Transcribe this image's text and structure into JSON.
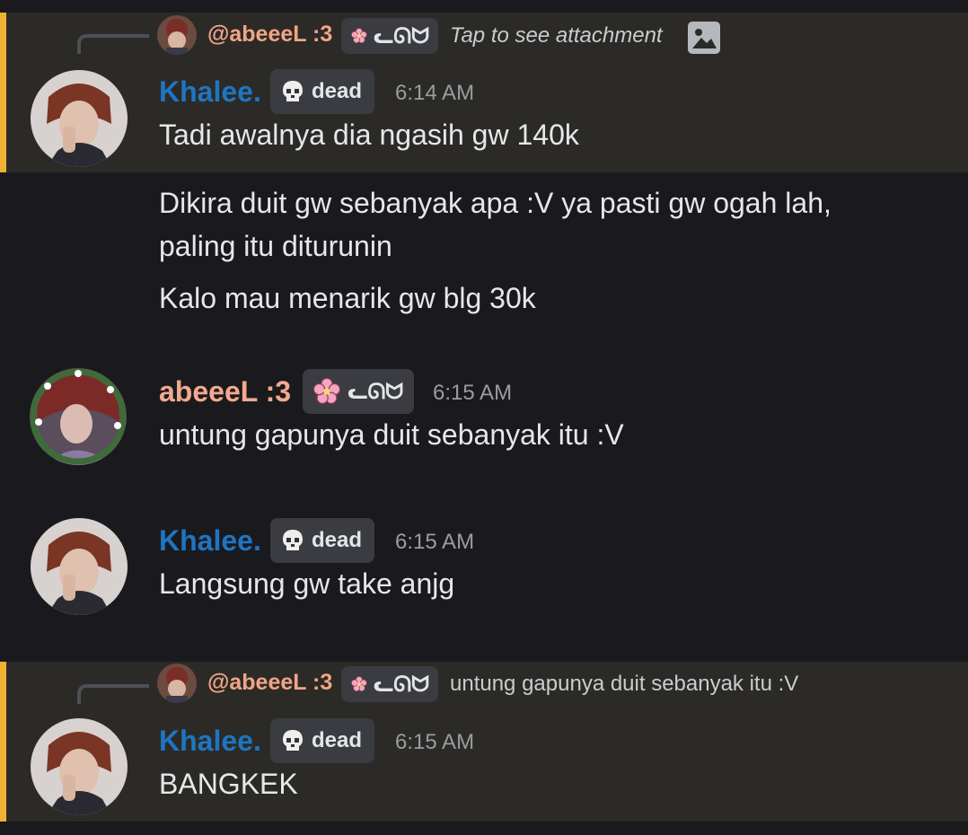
{
  "messages": [
    {
      "reply": {
        "name": "@abeeeL :3",
        "tag": "ᓚᘏᗢ",
        "text": "Tap to see attachment",
        "icon": "image-icon"
      },
      "author": "Khalee.",
      "tag": "dead",
      "tag_icon": "skull-icon",
      "time": "6:14 AM",
      "text": "Tadi awalnya dia ngasih gw 140k"
    },
    {
      "text": "Dikira duit gw sebanyak apa :V ya pasti gw ogah lah, paling itu diturunin"
    },
    {
      "text": "Kalo mau menarik gw blg 30k"
    },
    {
      "author": "abeeeL :3",
      "tag": "ᓚᘏᗢ",
      "tag_icon": "sakura-icon",
      "time": "6:15 AM",
      "text": "untung gapunya duit sebanyak itu :V"
    },
    {
      "author": "Khalee.",
      "tag": "dead",
      "tag_icon": "skull-icon",
      "time": "6:15 AM",
      "text": "Langsung gw take anjg"
    },
    {
      "reply": {
        "name": "@abeeeL :3",
        "tag": "ᓚᘏᗢ",
        "text": "untung gapunya duit sebanyak itu :V"
      },
      "author": "Khalee.",
      "tag": "dead",
      "tag_icon": "skull-icon",
      "time": "6:15 AM",
      "text": "BANGKEK"
    }
  ],
  "colors": {
    "background": "#1a1a1e",
    "highlight": "#2c2a26",
    "highlight_bar": "#f0b232",
    "name_khalee": "#1f75c2",
    "name_abeeel": "#f2a98f"
  }
}
